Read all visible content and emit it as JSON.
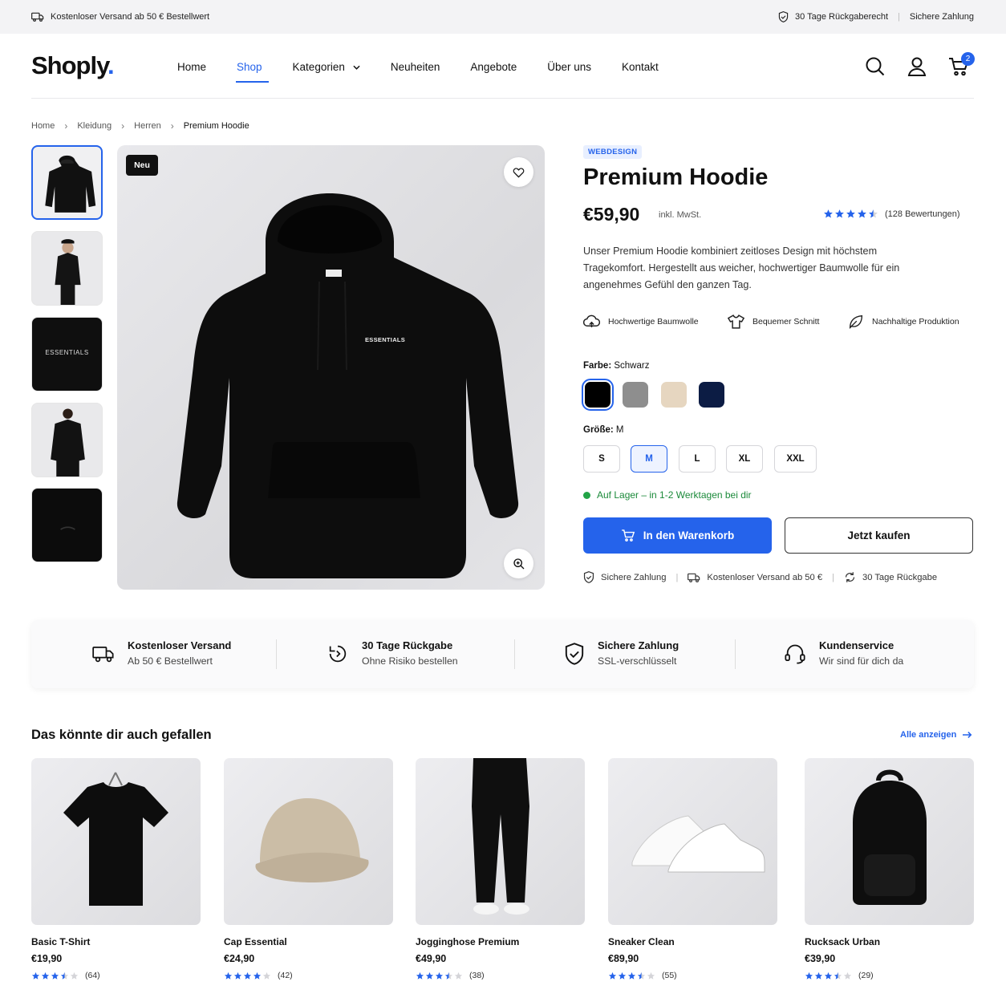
{
  "topbar": {
    "shipping": "Kostenloser Versand ab 50 € Bestellwert",
    "returns": "30 Tage Rückgaberecht",
    "payment": "Sichere Zahlung"
  },
  "header": {
    "logo": "Shoply",
    "logo_dot": ".",
    "nav": [
      "Home",
      "Shop",
      "Kategorien",
      "Neuheiten",
      "Angebote",
      "Über uns",
      "Kontakt"
    ],
    "active_nav": "Shop",
    "cart_count": "2"
  },
  "breadcrumb": [
    "Home",
    "Kleidung",
    "Herren",
    "Premium Hoodie"
  ],
  "gallery": {
    "thumbnails": [
      "hoodie-front",
      "model-side",
      "print-detail",
      "model-back",
      "fabric-detail"
    ],
    "thumb_print": "ESSENTIALS",
    "print_text": "ESSENTIALS",
    "badge": "Neu"
  },
  "product": {
    "category_badge": "WEBDESIGN",
    "title": "Premium Hoodie",
    "price": "€59,90",
    "tax_note": "inkl. MwSt.",
    "rating": 4.5,
    "reviews": "(128 Bewertungen)",
    "description": "Unser Premium Hoodie kombiniert zeitloses Design mit höchstem Tragekomfort. Hergestellt aus weicher, hochwertiger Baumwolle für ein angenehmes Gefühl den ganzen Tag.",
    "features": [
      "Hochwertige Baumwolle",
      "Bequemer Schnitt",
      "Nachhaltige Produktion"
    ],
    "color_label": "Farbe:",
    "color_value": "Schwarz",
    "colors": [
      "#000000",
      "#8e8e8e",
      "#e6d6c0",
      "#0c1c44"
    ],
    "size_label": "Größe:",
    "size_value": "M",
    "sizes": [
      "S",
      "M",
      "L",
      "XL",
      "XXL"
    ],
    "stock": "Auf Lager – in 1-2 Werktagen bei dir",
    "add_to_cart": "In den Warenkorb",
    "buy_now": "Jetzt kaufen",
    "trust": [
      "Sichere Zahlung",
      "Kostenloser Versand ab 50 €",
      "30 Tage Rückgabe"
    ]
  },
  "benefits": [
    {
      "title": "Kostenloser Versand",
      "sub": "Ab 50 € Bestellwert",
      "icon": "truck-icon"
    },
    {
      "title": "30 Tage Rückgabe",
      "sub": "Ohne Risiko bestellen",
      "icon": "return-icon"
    },
    {
      "title": "Sichere Zahlung",
      "sub": "SSL-verschlüsselt",
      "icon": "shield-check-icon"
    },
    {
      "title": "Kundenservice",
      "sub": "Wir sind für dich da",
      "icon": "headset-icon"
    }
  ],
  "related": {
    "title": "Das könnte dir auch gefallen",
    "view_all": "Alle anzeigen",
    "products": [
      {
        "name": "Basic T-Shirt",
        "price": "€19,90",
        "rating": 3.5,
        "count": "(64)"
      },
      {
        "name": "Cap Essential",
        "price": "€24,90",
        "rating": 4,
        "count": "(42)"
      },
      {
        "name": "Jogginghose Premium",
        "price": "€49,90",
        "rating": 3.5,
        "count": "(38)"
      },
      {
        "name": "Sneaker Clean",
        "price": "€89,90",
        "rating": 3.5,
        "count": "(55)"
      },
      {
        "name": "Rucksack Urban",
        "price": "€39,90",
        "rating": 3.5,
        "count": "(29)"
      }
    ]
  },
  "colors": {
    "accent": "#2563eb",
    "star": "#2563eb",
    "stock": "#1b8a3a"
  }
}
